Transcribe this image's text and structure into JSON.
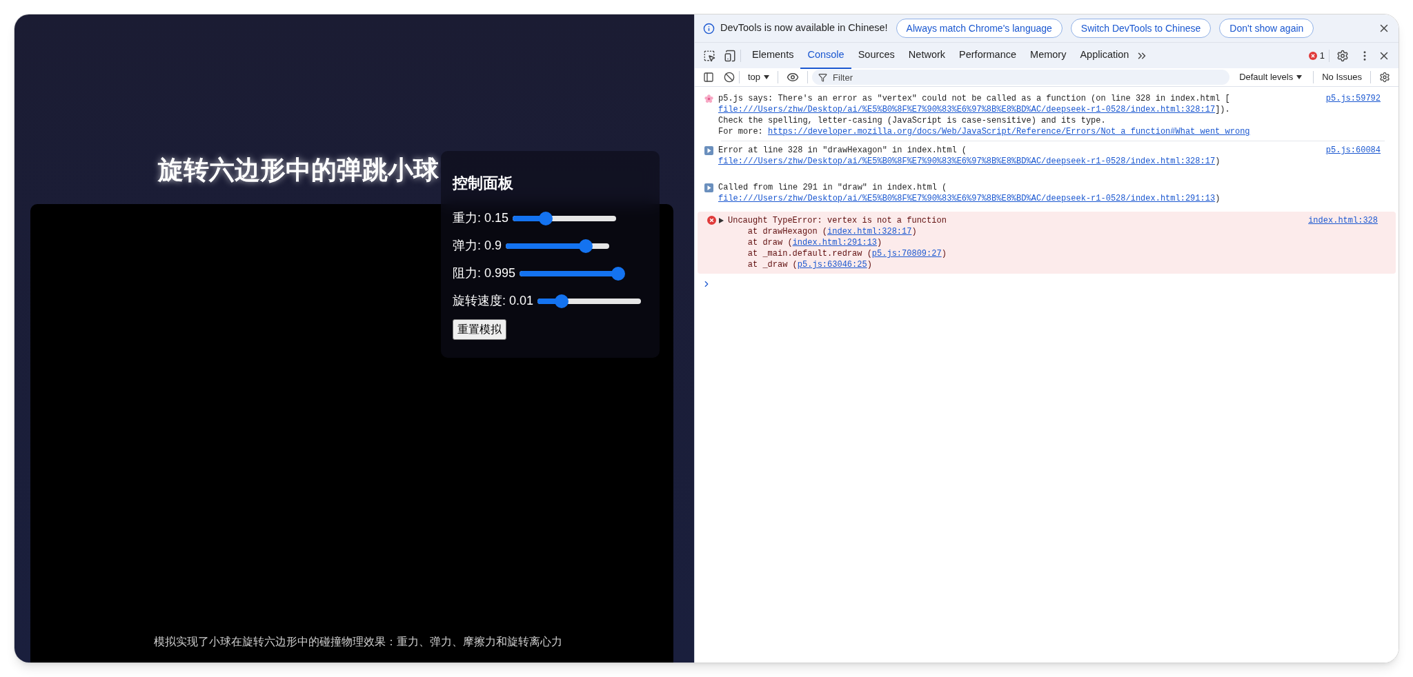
{
  "page": {
    "title": "旋转六边形中的弹跳小球",
    "panel": {
      "title": "控制面板",
      "sliders": [
        {
          "label": "重力: 0.15",
          "level": 0.32
        },
        {
          "label": "弹力: 0.9",
          "level": 0.77
        },
        {
          "label": "阻力: 0.995",
          "level": 0.95
        },
        {
          "label": "旋转速度: 0.01",
          "level": 0.23
        }
      ],
      "button": "重置模拟"
    },
    "caption": "模拟实现了小球在旋转六边形中的碰撞物理效果：重力、弹力、摩擦力和旋转离心力"
  },
  "devtools": {
    "infobar": {
      "message": "DevTools is now available in Chinese!",
      "buttons": [
        "Always match Chrome's language",
        "Switch DevTools to Chinese",
        "Don't show again"
      ]
    },
    "tabs": [
      {
        "label": "Elements",
        "selected": false
      },
      {
        "label": "Console",
        "selected": true
      },
      {
        "label": "Sources",
        "selected": false
      },
      {
        "label": "Network",
        "selected": false
      },
      {
        "label": "Performance",
        "selected": false
      },
      {
        "label": "Memory",
        "selected": false
      },
      {
        "label": "Application",
        "selected": false
      }
    ],
    "error_count": "1",
    "toolbar": {
      "context": "top",
      "filter_placeholder": "Filter",
      "levels": "Default levels",
      "issues": "No Issues"
    },
    "messages": [
      {
        "kind": "friendly",
        "source": "p5.js:59792",
        "lines": [
          [
            {
              "text": "p5.js says: There's an error as \"vertex\" could not be called as a function (on line 328 in index.html [",
              "link": false
            }
          ],
          [
            {
              "text": "file:///Users/zhw/Desktop/ai/%E5%B0%8F%E7%90%83%E6%97%8B%E8%BD%AC/deepseek-r1-0528/index.html:328:17",
              "link": true
            },
            {
              "text": "]).",
              "link": false
            }
          ],
          [
            {
              "text": "Check the spelling, letter-casing (JavaScript is case-sensitive) and its type.",
              "link": false
            }
          ],
          [
            {
              "text": "For more: ",
              "link": false
            },
            {
              "text": "https://developer.mozilla.org/docs/Web/JavaScript/Reference/Errors/Not_a_function#What_went_wrong",
              "link": true
            }
          ]
        ]
      },
      {
        "kind": "log",
        "source": "p5.js:60084",
        "lines": [
          [
            {
              "text": "Error at line 328 in \"drawHexagon\" in index.html (",
              "link": false
            }
          ],
          [
            {
              "text": "file:///Users/zhw/Desktop/ai/%E5%B0%8F%E7%90%83%E6%97%8B%E8%BD%AC/deepseek-r1-0528/index.html:328:17",
              "link": true
            },
            {
              "text": ")",
              "link": false
            }
          ]
        ]
      },
      {
        "kind": "log",
        "lines": [
          [
            {
              "text": "Called from line 291 in \"draw\" in index.html (",
              "link": false
            }
          ],
          [
            {
              "text": "file:///Users/zhw/Desktop/ai/%E5%B0%8F%E7%90%83%E6%97%8B%E8%BD%AC/deepseek-r1-0528/index.html:291:13",
              "link": true
            },
            {
              "text": ")",
              "link": false
            }
          ]
        ]
      },
      {
        "kind": "error",
        "source": "index.html:328",
        "lines": [
          [
            {
              "text": "Uncaught TypeError: vertex is not a function",
              "link": false
            }
          ],
          [
            {
              "text": "    at drawHexagon (",
              "link": false
            },
            {
              "text": "index.html:328:17",
              "link": true
            },
            {
              "text": ")",
              "link": false
            }
          ],
          [
            {
              "text": "    at draw (",
              "link": false
            },
            {
              "text": "index.html:291:13",
              "link": true
            },
            {
              "text": ")",
              "link": false
            }
          ],
          [
            {
              "text": "    at _main.default.redraw (",
              "link": false
            },
            {
              "text": "p5.js:70809:27",
              "link": true
            },
            {
              "text": ")",
              "link": false
            }
          ],
          [
            {
              "text": "    at _draw (",
              "link": false
            },
            {
              "text": "p5.js:63046:25",
              "link": true
            },
            {
              "text": ")",
              "link": false
            }
          ]
        ]
      }
    ]
  }
}
